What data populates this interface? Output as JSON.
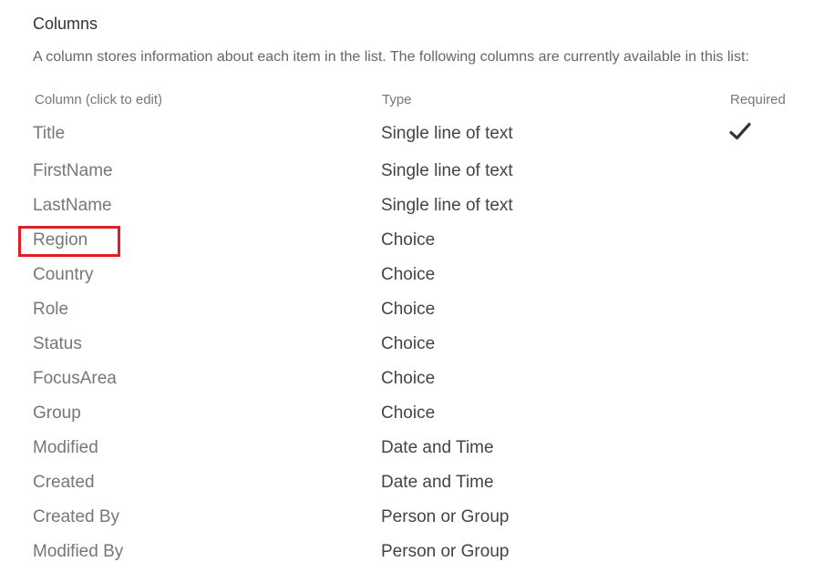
{
  "section": {
    "title": "Columns",
    "description": "A column stores information about each item in the list. The following columns are currently available in this list:"
  },
  "table": {
    "headers": {
      "name": "Column (click to edit)",
      "type": "Type",
      "required": "Required"
    },
    "rows": [
      {
        "name": "Title",
        "type": "Single line of text",
        "required": true
      },
      {
        "name": "FirstName",
        "type": "Single line of text",
        "required": false
      },
      {
        "name": "LastName",
        "type": "Single line of text",
        "required": false
      },
      {
        "name": "Region",
        "type": "Choice",
        "required": false,
        "highlighted": true
      },
      {
        "name": "Country",
        "type": "Choice",
        "required": false
      },
      {
        "name": "Role",
        "type": "Choice",
        "required": false
      },
      {
        "name": "Status",
        "type": "Choice",
        "required": false
      },
      {
        "name": "FocusArea",
        "type": "Choice",
        "required": false
      },
      {
        "name": "Group",
        "type": "Choice",
        "required": false
      },
      {
        "name": "Modified",
        "type": "Date and Time",
        "required": false
      },
      {
        "name": "Created",
        "type": "Date and Time",
        "required": false
      },
      {
        "name": "Created By",
        "type": "Person or Group",
        "required": false
      },
      {
        "name": "Modified By",
        "type": "Person or Group",
        "required": false
      }
    ]
  },
  "icons": {
    "required_check": "checkmark-icon"
  },
  "colors": {
    "highlight_border": "#e31b23"
  }
}
